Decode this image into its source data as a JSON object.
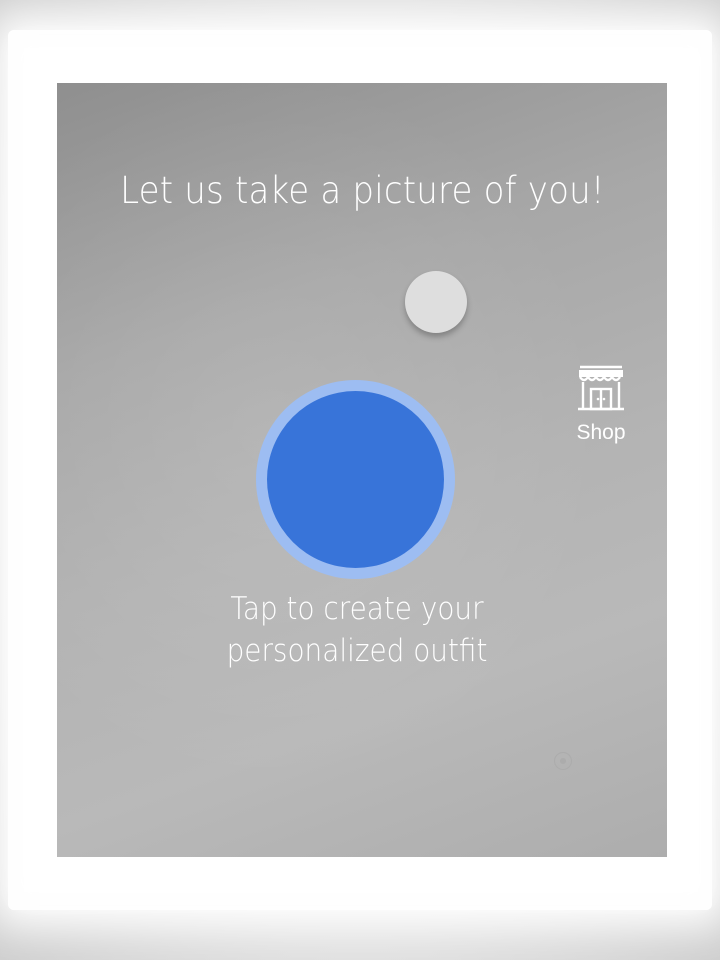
{
  "screen": {
    "title": "Let us take a picture of you!",
    "caption_line1": "Tap to create your",
    "caption_line2": "personalized outfit"
  },
  "shop": {
    "label": "Shop",
    "icon": "storefront-icon"
  },
  "colors": {
    "capture_button": "#3874d9",
    "capture_ring": "#9dbdf2",
    "text": "#ffffff"
  }
}
